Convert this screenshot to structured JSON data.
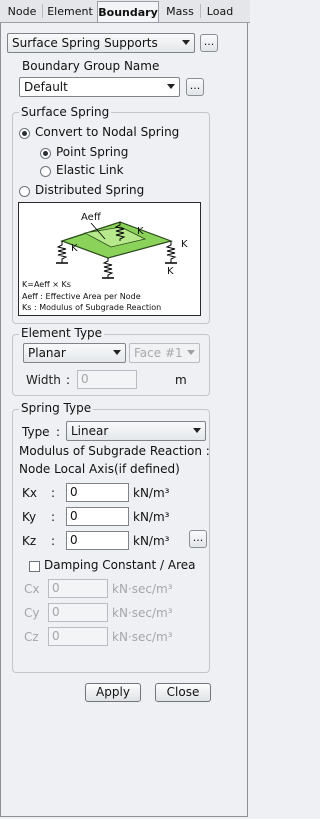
{
  "tabs": [
    {
      "label": "Node",
      "active": false
    },
    {
      "label": "Element",
      "active": false
    },
    {
      "label": "Boundary",
      "active": true
    },
    {
      "label": "Mass",
      "active": false
    },
    {
      "label": "Load",
      "active": false
    }
  ],
  "function_select": {
    "value": "Surface Spring Supports",
    "button": "..."
  },
  "boundary_group": {
    "legend": "Boundary Group Name",
    "value": "Default",
    "button": "..."
  },
  "surface_spring": {
    "legend": "Surface Spring",
    "convert_to_nodal": "Convert to Nodal Spring",
    "point_spring": "Point Spring",
    "elastic_link": "Elastic Link",
    "distributed_spring": "Distributed Spring",
    "figure": {
      "aeff_label": "Aeff",
      "k_labels": [
        "K",
        "K",
        "K",
        "K"
      ],
      "formula": "K=Aeff × Ks",
      "aeff_desc": "Aeff : Effective Area per Node",
      "ks_desc": "Ks   : Modulus of Subgrade Reaction",
      "plate_color": "#8ad25a"
    }
  },
  "element_type": {
    "legend": "Element Type",
    "type_value": "Planar",
    "face_value": "Face #1",
    "width_label": "Width",
    "width_colon": ":",
    "width_value": "0",
    "width_unit": "m"
  },
  "spring_type": {
    "legend": "Spring Type",
    "type_label": "Type",
    "type_colon": ":",
    "type_value": "Linear",
    "modulus_title": "Modulus of Subgrade Reaction :",
    "local_axis": "Node Local Axis(if defined)",
    "colon": ":",
    "kx": {
      "label": "Kx",
      "value": "0",
      "unit": "kN/m³"
    },
    "ky": {
      "label": "Ky",
      "value": "0",
      "unit": "kN/m³"
    },
    "kz": {
      "label": "Kz",
      "value": "0",
      "unit": "kN/m³"
    },
    "kz_button": "...",
    "damping_label": "Damping Constant / Area",
    "cx": {
      "label": "Cx",
      "value": "0",
      "unit": "kN·sec/m³"
    },
    "cy": {
      "label": "Cy",
      "value": "0",
      "unit": "kN·sec/m³"
    },
    "cz": {
      "label": "Cz",
      "value": "0",
      "unit": "kN·sec/m³"
    }
  },
  "actions": {
    "apply": "Apply",
    "close": "Close"
  }
}
